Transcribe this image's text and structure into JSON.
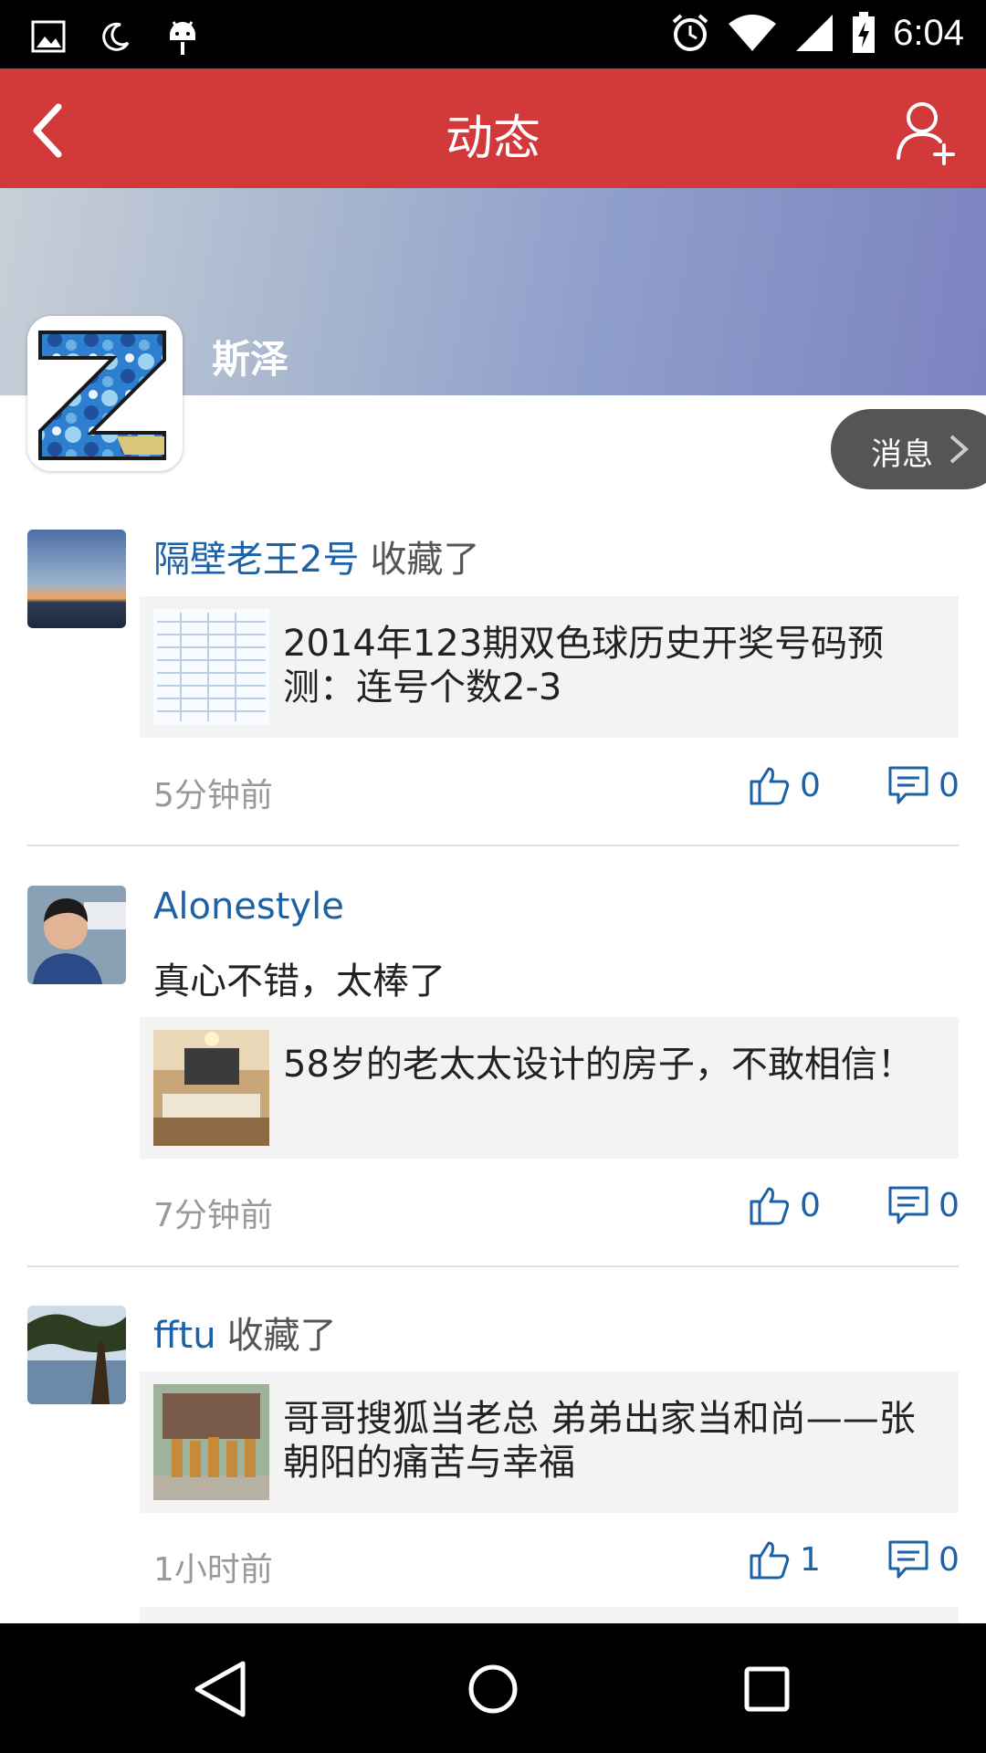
{
  "status_bar": {
    "time": "6:04",
    "left_icons": [
      "image-icon",
      "moon-icon",
      "android-icon"
    ],
    "right_icons": [
      "alarm-icon",
      "wifi-icon",
      "signal-icon",
      "battery-charging-icon"
    ]
  },
  "header": {
    "title": "动态",
    "back_icon": "chevron-left-icon",
    "add_friend_icon": "add-user-icon"
  },
  "profile": {
    "name": "斯泽",
    "message_button": "消息"
  },
  "feed": [
    {
      "username": "隔壁老王2号",
      "action": "收藏了",
      "comment": "",
      "card_title": "2014年123期双色球历史开奖号码预测：连号个数2-3",
      "time": "5分钟前",
      "likes": "0",
      "comments": "0"
    },
    {
      "username": "Alonestyle",
      "action": "",
      "comment": "真心不错，太棒了",
      "card_title": "58岁的老太太设计的房子，不敢相信！",
      "time": "7分钟前",
      "likes": "0",
      "comments": "0"
    },
    {
      "username": "fftu",
      "action": "收藏了",
      "comment": "",
      "card_title": "哥哥搜狐当老总 弟弟出家当和尚——张朝阳的痛苦与幸福",
      "time": "1小时前",
      "likes": "1",
      "comments": "0"
    }
  ],
  "colors": {
    "accent": "#d1393b",
    "link": "#1c62a8"
  }
}
